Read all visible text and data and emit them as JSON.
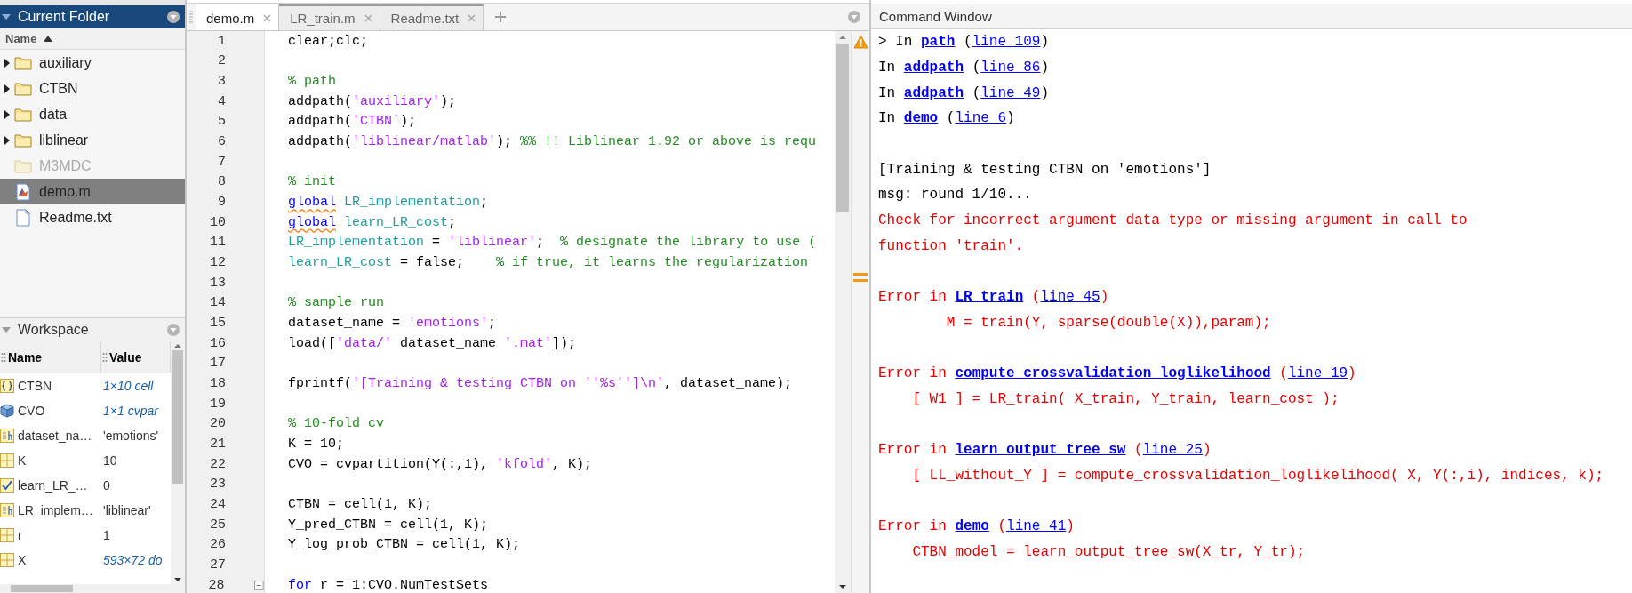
{
  "current_folder": {
    "title": "Current Folder",
    "column": "Name",
    "items": [
      {
        "name": "auxiliary",
        "kind": "folder",
        "expandable": true,
        "disabled": false,
        "selected": false
      },
      {
        "name": "CTBN",
        "kind": "folder",
        "expandable": true,
        "disabled": false,
        "selected": false
      },
      {
        "name": "data",
        "kind": "folder",
        "expandable": true,
        "disabled": false,
        "selected": false
      },
      {
        "name": "liblinear",
        "kind": "folder",
        "expandable": true,
        "disabled": false,
        "selected": false
      },
      {
        "name": "M3MDC",
        "kind": "folder",
        "expandable": false,
        "disabled": true,
        "selected": false
      },
      {
        "name": "demo.m",
        "kind": "script",
        "expandable": false,
        "disabled": false,
        "selected": true
      },
      {
        "name": "Readme.txt",
        "kind": "text",
        "expandable": false,
        "disabled": false,
        "selected": false
      }
    ]
  },
  "workspace": {
    "title": "Workspace",
    "columns": [
      "Name",
      "Value"
    ],
    "rows": [
      {
        "name": "CTBN",
        "value": "1×10 cell",
        "kind": "cell",
        "italic": true
      },
      {
        "name": "CVO",
        "value": "1×1 cvpar",
        "kind": "object",
        "italic": true
      },
      {
        "name": "dataset_na…",
        "value": "'emotions'",
        "kind": "char",
        "italic": false
      },
      {
        "name": "K",
        "value": "10",
        "kind": "matrix",
        "italic": false
      },
      {
        "name": "learn_LR_…",
        "value": "0",
        "kind": "logical",
        "italic": false
      },
      {
        "name": "LR_implem…",
        "value": "'liblinear'",
        "kind": "char",
        "italic": false
      },
      {
        "name": "r",
        "value": "1",
        "kind": "matrix",
        "italic": false
      },
      {
        "name": "X",
        "value": "593×72 do",
        "kind": "matrix",
        "italic": true
      }
    ]
  },
  "editor": {
    "tabs": [
      {
        "label": "demo.m",
        "selected": true
      },
      {
        "label": "LR_train.m",
        "selected": false
      },
      {
        "label": "Readme.txt",
        "selected": false
      }
    ],
    "lines": [
      {
        "number": "1",
        "tokens": [
          {
            "kind": "plain",
            "text": "clear;clc;"
          }
        ]
      },
      {
        "number": "2"
      },
      {
        "number": "3",
        "tokens": [
          {
            "kind": "comment",
            "text": "% path"
          }
        ]
      },
      {
        "number": "4",
        "tokens": [
          {
            "kind": "plain",
            "text": "addpath("
          },
          {
            "kind": "string",
            "text": "'auxiliary'"
          },
          {
            "kind": "plain",
            "text": ");"
          }
        ]
      },
      {
        "number": "5",
        "tokens": [
          {
            "kind": "plain",
            "text": "addpath("
          },
          {
            "kind": "string",
            "text": "'CTBN'"
          },
          {
            "kind": "plain",
            "text": ");"
          }
        ]
      },
      {
        "number": "6",
        "tokens": [
          {
            "kind": "plain",
            "text": "addpath("
          },
          {
            "kind": "string",
            "text": "'liblinear/matlab'"
          },
          {
            "kind": "plain",
            "text": "); "
          },
          {
            "kind": "comment",
            "text": "%% !! Liblinear 1.92 or above is requ"
          }
        ]
      },
      {
        "number": "7"
      },
      {
        "number": "8",
        "tokens": [
          {
            "kind": "comment",
            "text": "% init"
          }
        ]
      },
      {
        "number": "9",
        "tokens": [
          {
            "kind": "keyword_flagged",
            "text": "global"
          },
          {
            "kind": "global",
            "text": " LR_implementation"
          },
          {
            "kind": "plain",
            "text": ";"
          }
        ]
      },
      {
        "number": "10",
        "tokens": [
          {
            "kind": "keyword_flagged",
            "text": "global"
          },
          {
            "kind": "global",
            "text": " learn_LR_cost"
          },
          {
            "kind": "plain",
            "text": ";"
          }
        ]
      },
      {
        "number": "11",
        "tokens": [
          {
            "kind": "global",
            "text": "LR_implementation"
          },
          {
            "kind": "plain",
            "text": " = "
          },
          {
            "kind": "string",
            "text": "'liblinear'"
          },
          {
            "kind": "plain",
            "text": ";  "
          },
          {
            "kind": "comment",
            "text": "% designate the library to use ("
          }
        ]
      },
      {
        "number": "12",
        "tokens": [
          {
            "kind": "global",
            "text": "learn_LR_cost"
          },
          {
            "kind": "plain",
            "text": " = false;    "
          },
          {
            "kind": "comment",
            "text": "% if true, it learns the regularization"
          }
        ]
      },
      {
        "number": "13"
      },
      {
        "number": "14",
        "tokens": [
          {
            "kind": "comment",
            "text": "% sample run"
          }
        ]
      },
      {
        "number": "15",
        "tokens": [
          {
            "kind": "plain",
            "text": "dataset_name = "
          },
          {
            "kind": "string",
            "text": "'emotions'"
          },
          {
            "kind": "plain",
            "text": ";"
          }
        ]
      },
      {
        "number": "16",
        "tokens": [
          {
            "kind": "plain",
            "text": "load(["
          },
          {
            "kind": "string",
            "text": "'data/'"
          },
          {
            "kind": "plain",
            "text": " dataset_name "
          },
          {
            "kind": "string",
            "text": "'.mat'"
          },
          {
            "kind": "plain",
            "text": "]);"
          }
        ]
      },
      {
        "number": "17"
      },
      {
        "number": "18",
        "tokens": [
          {
            "kind": "plain",
            "text": "fprintf("
          },
          {
            "kind": "string",
            "text": "'[Training & testing CTBN on ''%s'']\\n'"
          },
          {
            "kind": "plain",
            "text": ", dataset_name);"
          }
        ]
      },
      {
        "number": "19"
      },
      {
        "number": "20",
        "tokens": [
          {
            "kind": "comment",
            "text": "% 10-fold cv"
          }
        ]
      },
      {
        "number": "21",
        "tokens": [
          {
            "kind": "plain",
            "text": "K = 10;"
          }
        ]
      },
      {
        "number": "22",
        "tokens": [
          {
            "kind": "plain",
            "text": "CVO = cvpartition(Y(:,1), "
          },
          {
            "kind": "string",
            "text": "'kfold'"
          },
          {
            "kind": "plain",
            "text": ", K);"
          }
        ]
      },
      {
        "number": "23"
      },
      {
        "number": "24",
        "tokens": [
          {
            "kind": "plain",
            "text": "CTBN = cell(1, K);"
          }
        ]
      },
      {
        "number": "25",
        "tokens": [
          {
            "kind": "plain",
            "text": "Y_pred_CTBN = cell(1, K);"
          }
        ]
      },
      {
        "number": "26",
        "tokens": [
          {
            "kind": "plain",
            "text": "Y_log_prob_CTBN = cell(1, K);"
          }
        ]
      },
      {
        "number": "27"
      },
      {
        "number": "28",
        "fold": true,
        "tokens": [
          {
            "kind": "keyword",
            "text": "for"
          },
          {
            "kind": "plain",
            "text": " r = 1:CVO.NumTestSets"
          }
        ]
      }
    ]
  },
  "command_window": {
    "title": "Command Window",
    "lines": [
      {
        "kind": "normal",
        "segments": [
          {
            "kind": "text",
            "text": "> In "
          },
          {
            "kind": "func",
            "text": "path"
          },
          {
            "kind": "text",
            "text": " ("
          },
          {
            "kind": "line_link",
            "text": "line 109"
          },
          {
            "kind": "text",
            "text": ")"
          }
        ]
      },
      {
        "kind": "normal",
        "segments": [
          {
            "kind": "text",
            "text": "In "
          },
          {
            "kind": "func",
            "text": "addpath"
          },
          {
            "kind": "text",
            "text": " ("
          },
          {
            "kind": "line_link",
            "text": "line 86"
          },
          {
            "kind": "text",
            "text": ")"
          }
        ]
      },
      {
        "kind": "normal",
        "segments": [
          {
            "kind": "text",
            "text": "In "
          },
          {
            "kind": "func",
            "text": "addpath"
          },
          {
            "kind": "text",
            "text": " ("
          },
          {
            "kind": "line_link",
            "text": "line 49"
          },
          {
            "kind": "text",
            "text": ")"
          }
        ]
      },
      {
        "kind": "normal",
        "segments": [
          {
            "kind": "text",
            "text": "In "
          },
          {
            "kind": "func",
            "text": "demo"
          },
          {
            "kind": "text",
            "text": " ("
          },
          {
            "kind": "line_link",
            "text": "line 6"
          },
          {
            "kind": "text",
            "text": ")"
          }
        ]
      },
      {
        "kind": "blank"
      },
      {
        "kind": "normal",
        "segments": [
          {
            "kind": "text",
            "text": "[Training & testing CTBN on 'emotions']"
          }
        ]
      },
      {
        "kind": "normal",
        "segments": [
          {
            "kind": "text",
            "text": "msg: round 1/10..."
          }
        ]
      },
      {
        "kind": "error",
        "segments": [
          {
            "kind": "text",
            "text": "Check for incorrect argument data type or missing argument in call to"
          }
        ]
      },
      {
        "kind": "error",
        "segments": [
          {
            "kind": "text",
            "text": "function 'train'."
          }
        ]
      },
      {
        "kind": "blank"
      },
      {
        "kind": "error",
        "segments": [
          {
            "kind": "text",
            "text": "Error in "
          },
          {
            "kind": "func",
            "text": "LR_train"
          },
          {
            "kind": "text",
            "text": " ("
          },
          {
            "kind": "line_link",
            "text": "line 45"
          },
          {
            "kind": "text",
            "text": ")"
          }
        ]
      },
      {
        "kind": "error",
        "segments": [
          {
            "kind": "text",
            "text": "        M = train(Y, sparse(double(X)),param);"
          }
        ]
      },
      {
        "kind": "blank"
      },
      {
        "kind": "error",
        "segments": [
          {
            "kind": "text",
            "text": "Error in "
          },
          {
            "kind": "func",
            "text": "compute_crossvalidation_loglikelihood"
          },
          {
            "kind": "text",
            "text": " ("
          },
          {
            "kind": "line_link",
            "text": "line 19"
          },
          {
            "kind": "text",
            "text": ")"
          }
        ]
      },
      {
        "kind": "error",
        "segments": [
          {
            "kind": "text",
            "text": "    [ W1 ] = LR_train( X_train, Y_train, learn_cost );"
          }
        ]
      },
      {
        "kind": "blank"
      },
      {
        "kind": "error",
        "segments": [
          {
            "kind": "text",
            "text": "Error in "
          },
          {
            "kind": "func",
            "text": "learn_output_tree_sw"
          },
          {
            "kind": "text",
            "text": " ("
          },
          {
            "kind": "line_link",
            "text": "line 25"
          },
          {
            "kind": "text",
            "text": ")"
          }
        ]
      },
      {
        "kind": "error",
        "segments": [
          {
            "kind": "text",
            "text": "    [ LL_without_Y ] = compute_crossvalidation_loglikelihood( X, Y(:,i), indices, k);"
          }
        ]
      },
      {
        "kind": "blank"
      },
      {
        "kind": "error",
        "segments": [
          {
            "kind": "text",
            "text": "Error in "
          },
          {
            "kind": "func",
            "text": "demo"
          },
          {
            "kind": "text",
            "text": " ("
          },
          {
            "kind": "line_link",
            "text": "line 41"
          },
          {
            "kind": "text",
            "text": ")"
          }
        ]
      },
      {
        "kind": "error",
        "segments": [
          {
            "kind": "text",
            "text": "    CTBN_model = learn_output_tree_sw(X_tr, Y_tr);"
          }
        ]
      }
    ]
  }
}
